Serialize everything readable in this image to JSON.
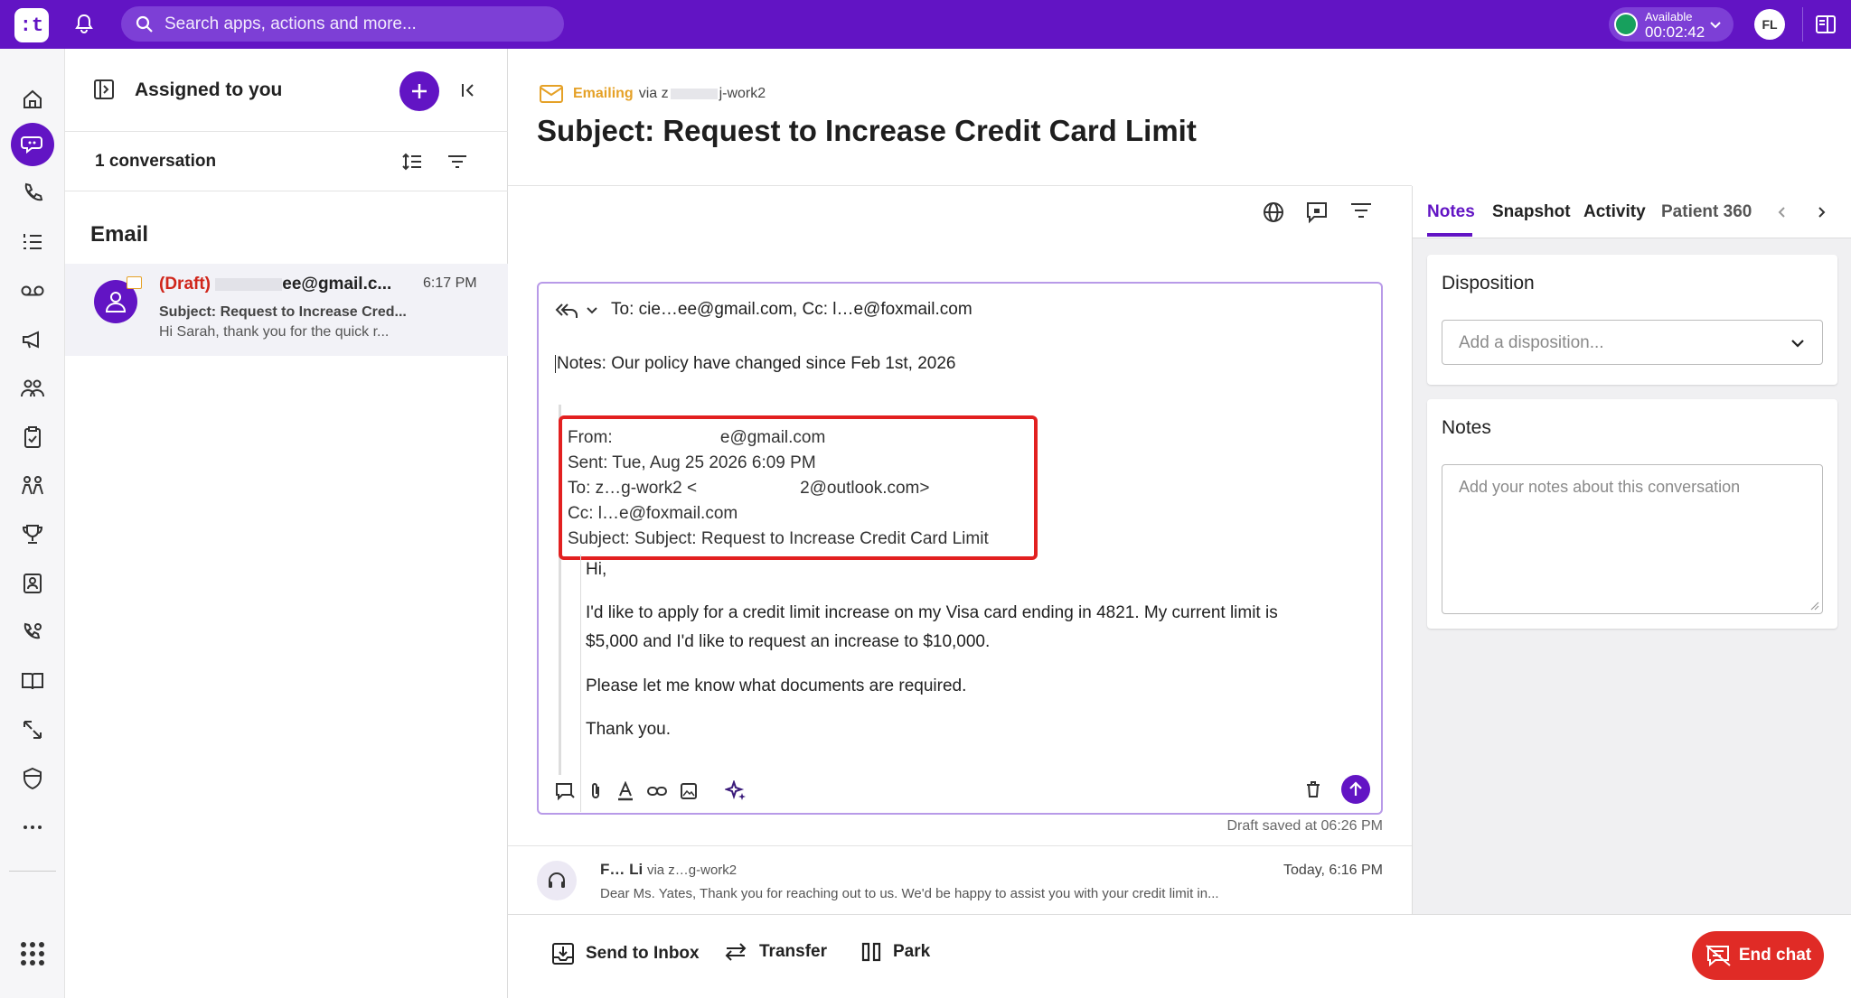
{
  "topbar": {
    "logo": ":t",
    "search_placeholder": "Search apps, actions and more...",
    "status_label": "Available",
    "status_timer": "00:02:42",
    "avatar_initials": "FL",
    "status_color": "#17a05d",
    "brand_color": "#6214c4"
  },
  "left_rail": {
    "items": [
      "home-icon",
      "conversations-icon",
      "phone-icon",
      "list-icon",
      "voicemail-icon",
      "megaphone-icon",
      "team-icon",
      "clipboard-icon",
      "people-icon",
      "trophy-icon",
      "contact-icon",
      "call-settings-icon",
      "book-icon",
      "routing-icon",
      "shield-icon",
      "more-icon"
    ],
    "apps_icon": "apps-grid-icon"
  },
  "list_panel": {
    "title": "Assigned to you",
    "count": "1 conversation",
    "section": "Email",
    "conversation": {
      "draft_label": "(Draft)",
      "sender": "ee@gmail.c...",
      "time": "6:17 PM",
      "subject": "Subject: Request to Increase Cred...",
      "preview": "Hi Sarah, thank you for the quick r..."
    }
  },
  "main": {
    "channel_label": "Emailing",
    "via_text": "via z",
    "via_account": "j-work2",
    "subject": "Subject: Request to Increase Credit Card Limit",
    "composer": {
      "to_line": "To: cіе…ee@gmail.com, Cc: l…e@foxmail.com",
      "note": "Notes: Our policy have changed since Feb 1st, 2026",
      "quoted_header": {
        "from": "From:       e@gmail.com",
        "sent": "Sent: Tue, Aug 25 2026 6:09 PM",
        "to": "To: z…g-work2 <      2@outlook.com>",
        "cc": "Cc: l…e@foxmail.com",
        "subject": "Subject: Subject: Request to Increase Credit Card Limit"
      },
      "body": {
        "greeting": "Hi,",
        "p1_line1": "I'd like to apply for a credit limit increase on my Visa card ending in 4821. My current limit is",
        "p1_line2": "$5,000 and I'd like to request an increase to $10,000.",
        "p2": "Please let me know what documents are required.",
        "p3": "Thank you."
      }
    },
    "draft_saved": "Draft saved at 06:26 PM",
    "reply": {
      "sender": "F… Li",
      "via": "via z…g-work2",
      "time": "Today, 6:16 PM",
      "preview": "Dear Ms. Yates, Thank you for reaching out to us. We'd be happy to assist you with your credit limit in..."
    }
  },
  "bottom_bar": {
    "send_to_inbox": "Send to Inbox",
    "transfer": "Transfer",
    "park": "Park",
    "end_chat": "End chat"
  },
  "right_panel": {
    "tabs": [
      "Notes",
      "Snapshot",
      "Activity",
      "Patient 360"
    ],
    "disposition_title": "Disposition",
    "disposition_placeholder": "Add a disposition...",
    "notes_title": "Notes",
    "notes_placeholder": "Add your notes about this conversation"
  }
}
